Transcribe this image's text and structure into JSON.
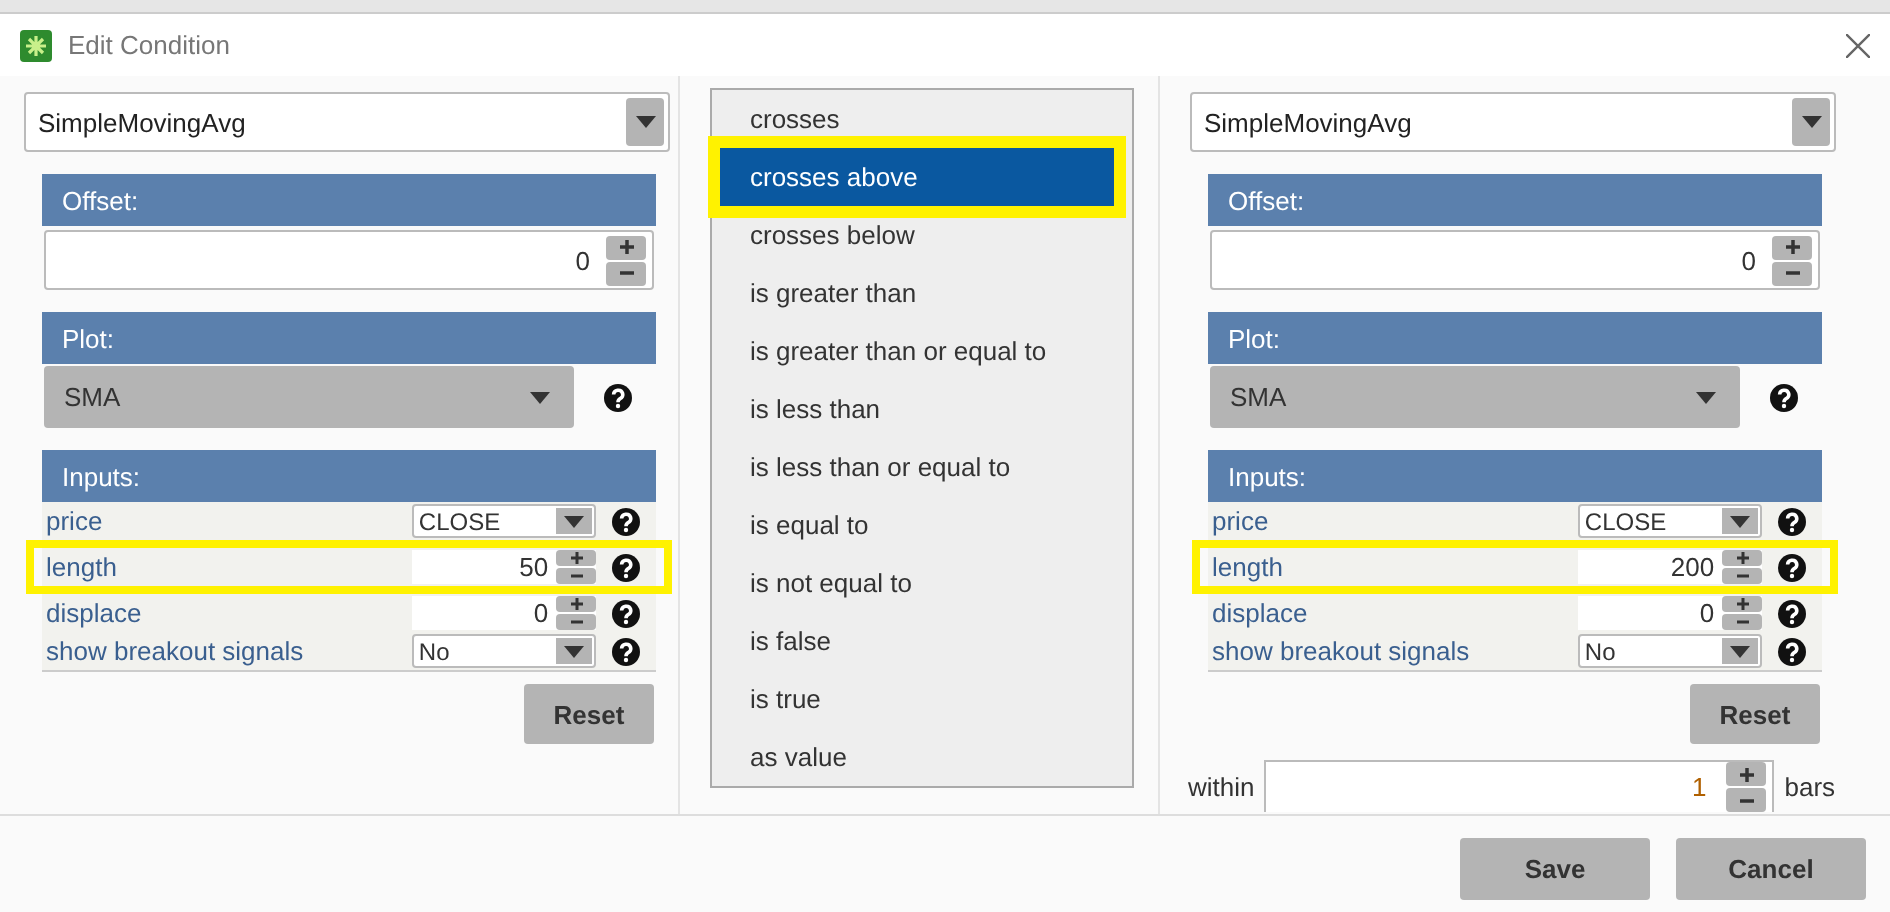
{
  "window": {
    "title": "Edit Condition"
  },
  "left": {
    "study": "SimpleMovingAvg",
    "offset": {
      "label": "Offset:",
      "value": "0"
    },
    "plot": {
      "label": "Plot:",
      "value": "SMA"
    },
    "inputs": {
      "label": "Inputs:",
      "rows": [
        {
          "name": "price",
          "kind": "select",
          "value": "CLOSE",
          "highlighted": false
        },
        {
          "name": "length",
          "kind": "number",
          "value": "50",
          "highlighted": true
        },
        {
          "name": "displace",
          "kind": "number",
          "value": "0",
          "highlighted": false
        },
        {
          "name": "show breakout signals",
          "kind": "select",
          "value": "No",
          "highlighted": false
        }
      ]
    },
    "reset": "Reset"
  },
  "operators": [
    {
      "label": "crosses",
      "selected": false,
      "highlighted": false
    },
    {
      "label": "crosses above",
      "selected": true,
      "highlighted": true
    },
    {
      "label": "crosses below",
      "selected": false,
      "highlighted": false
    },
    {
      "label": "is greater than",
      "selected": false,
      "highlighted": false
    },
    {
      "label": "is greater than or equal to",
      "selected": false,
      "highlighted": false
    },
    {
      "label": "is less than",
      "selected": false,
      "highlighted": false
    },
    {
      "label": "is less than or equal to",
      "selected": false,
      "highlighted": false
    },
    {
      "label": "is equal to",
      "selected": false,
      "highlighted": false
    },
    {
      "label": "is not equal to",
      "selected": false,
      "highlighted": false
    },
    {
      "label": "is false",
      "selected": false,
      "highlighted": false
    },
    {
      "label": "is true",
      "selected": false,
      "highlighted": false
    },
    {
      "label": "as value",
      "selected": false,
      "highlighted": false
    }
  ],
  "right": {
    "study": "SimpleMovingAvg",
    "offset": {
      "label": "Offset:",
      "value": "0"
    },
    "plot": {
      "label": "Plot:",
      "value": "SMA"
    },
    "inputs": {
      "label": "Inputs:",
      "rows": [
        {
          "name": "price",
          "kind": "select",
          "value": "CLOSE",
          "highlighted": false
        },
        {
          "name": "length",
          "kind": "number",
          "value": "200",
          "highlighted": true
        },
        {
          "name": "displace",
          "kind": "number",
          "value": "0",
          "highlighted": false
        },
        {
          "name": "show breakout signals",
          "kind": "select",
          "value": "No",
          "highlighted": false
        }
      ]
    },
    "reset": "Reset"
  },
  "within": {
    "label": "within",
    "value": "1",
    "unit": "bars"
  },
  "buttons": [
    {
      "label": "Save"
    },
    {
      "label": "Cancel"
    }
  ]
}
